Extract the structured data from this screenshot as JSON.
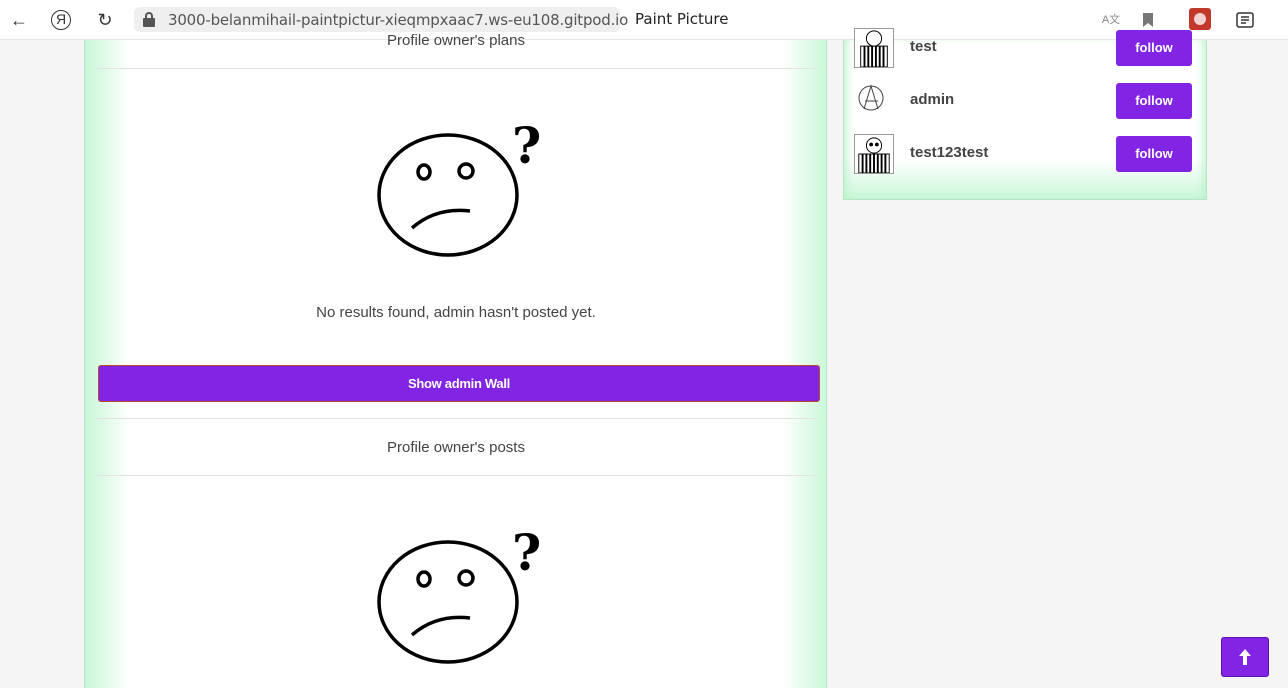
{
  "browser": {
    "url": "3000-belanmihail-paintpictur-xieqmpxaac7.ws-eu108.gitpod.io",
    "tab_title": "Paint Picture",
    "back_icon": "←",
    "yandex_icon": "Я",
    "reload_icon": "↻",
    "translate_icon": "A文",
    "bookmark_icon": "bookmark-icon",
    "extension_icon": "extension-icon",
    "reader_icon": "reader-icon"
  },
  "main": {
    "plans_title": "Profile owner's plans",
    "plans_empty": "No results found, admin hasn't posted yet.",
    "wall_button": "Show admin Wall",
    "posts_title": "Profile owner's posts",
    "accent_color": "#8224e3"
  },
  "sidebar": {
    "users": [
      {
        "name": "test",
        "follow_label": "follow",
        "avatar": "striped-avatar"
      },
      {
        "name": "admin",
        "follow_label": "follow",
        "avatar": "anarchy-avatar"
      },
      {
        "name": "test123test",
        "follow_label": "follow",
        "avatar": "striped-avatar"
      }
    ]
  },
  "scroll_top": {
    "icon": "🠕"
  }
}
